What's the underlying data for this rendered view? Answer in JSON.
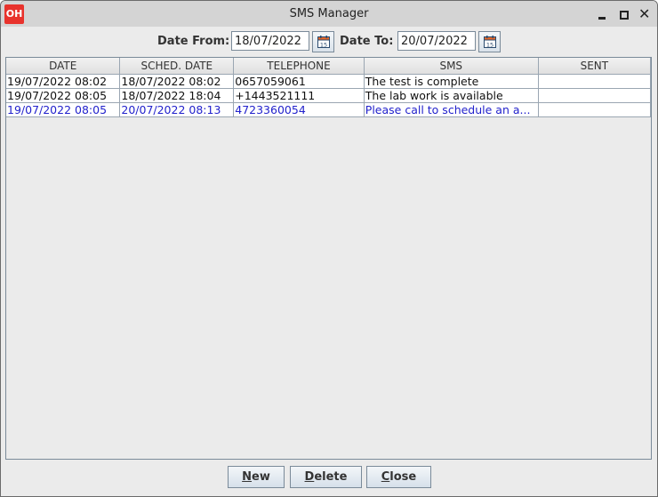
{
  "window": {
    "title": "SMS Manager",
    "logo_text": "OH",
    "controls": [
      "minimize",
      "maximize",
      "close"
    ]
  },
  "filters": {
    "date_from_label": "Date From:",
    "date_from_value": "18/07/2022",
    "date_to_label": "Date To:",
    "date_to_value": "20/07/2022",
    "calendar_icon": "calendar-icon",
    "calendar_day": "15"
  },
  "table": {
    "columns": [
      "DATE",
      "SCHED. DATE",
      "TELEPHONE",
      "SMS",
      "SENT"
    ],
    "rows": [
      [
        "19/07/2022 08:02",
        "18/07/2022 08:02",
        "0657059061",
        "The test is complete",
        ""
      ],
      [
        "19/07/2022 08:05",
        "18/07/2022 18:04",
        "+1443521111",
        "The lab work is available",
        ""
      ],
      [
        "19/07/2022 08:05",
        "20/07/2022 08:13",
        "4723360054",
        "Please call to schedule an a...",
        ""
      ]
    ],
    "selected_row": 2,
    "selected_color": "#2222cc"
  },
  "buttons": {
    "new": {
      "mnemonic": "N",
      "rest": "ew"
    },
    "delete": {
      "mnemonic": "D",
      "rest": "elete"
    },
    "close": {
      "mnemonic": "C",
      "rest": "lose"
    }
  },
  "colors": {
    "logo": "#e8322c",
    "background": "#ebebeb",
    "titlebar": "#d4d4d4"
  }
}
